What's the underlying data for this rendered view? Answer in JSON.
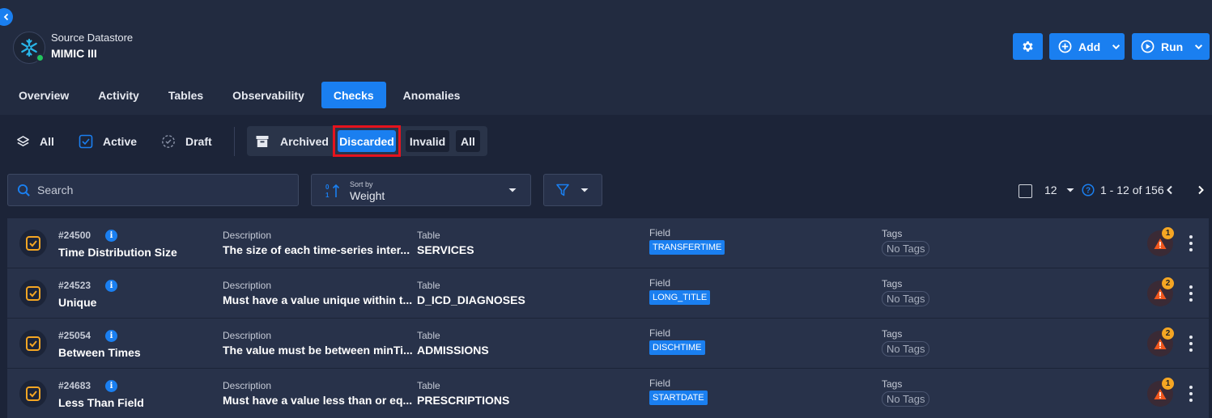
{
  "datastore": {
    "label": "Source Datastore",
    "name": "MIMIC III"
  },
  "header_actions": {
    "add_label": "Add",
    "run_label": "Run"
  },
  "tabs": [
    {
      "label": "Overview",
      "active": false
    },
    {
      "label": "Activity",
      "active": false
    },
    {
      "label": "Tables",
      "active": false
    },
    {
      "label": "Observability",
      "active": false
    },
    {
      "label": "Checks",
      "active": true
    },
    {
      "label": "Anomalies",
      "active": false
    }
  ],
  "status_filters": {
    "all": "All",
    "active": "Active",
    "draft": "Draft"
  },
  "archived_group": {
    "archived": "Archived",
    "discarded": "Discarded",
    "invalid": "Invalid",
    "all": "All",
    "selected": "Discarded"
  },
  "search": {
    "placeholder": "Search"
  },
  "sort": {
    "caption": "Sort by",
    "value": "Weight"
  },
  "pager": {
    "page_size": "12",
    "range": "1 - 12 of 156"
  },
  "columns": {
    "description": "Description",
    "table": "Table",
    "field": "Field",
    "tags": "Tags"
  },
  "rows": [
    {
      "id": "#24500",
      "name": "Time Distribution Size",
      "description": "The size of each time-series inter...",
      "table": "SERVICES",
      "field": "TRANSFERTIME",
      "tags": "No Tags",
      "anomalies": "1"
    },
    {
      "id": "#24523",
      "name": "Unique",
      "description": "Must have a value unique within t...",
      "table": "D_ICD_DIAGNOSES",
      "field": "LONG_TITLE",
      "tags": "No Tags",
      "anomalies": "2"
    },
    {
      "id": "#25054",
      "name": "Between Times",
      "description": "The value must be between minTi...",
      "table": "ADMISSIONS",
      "field": "DISCHTIME",
      "tags": "No Tags",
      "anomalies": "2"
    },
    {
      "id": "#24683",
      "name": "Less Than Field",
      "description": "Must have a value less than or eq...",
      "table": "PRESCRIPTIONS",
      "field": "STARTDATE",
      "tags": "No Tags",
      "anomalies": "1"
    }
  ],
  "colors": {
    "accent": "#1a7ff0",
    "check_icon": "#f5a623",
    "highlight": "#e5131d",
    "status_online": "#22c55e"
  },
  "icons": [
    "chevron-left-icon",
    "snowflake-icon",
    "gear-icon",
    "plus-circle-icon",
    "play-circle-icon",
    "chevron-down-icon",
    "layers-icon",
    "check-square-icon",
    "draft-icon",
    "archive-icon",
    "search-icon",
    "sort-icon",
    "filter-icon",
    "help-icon",
    "warning-icon",
    "kebab-icon"
  ]
}
